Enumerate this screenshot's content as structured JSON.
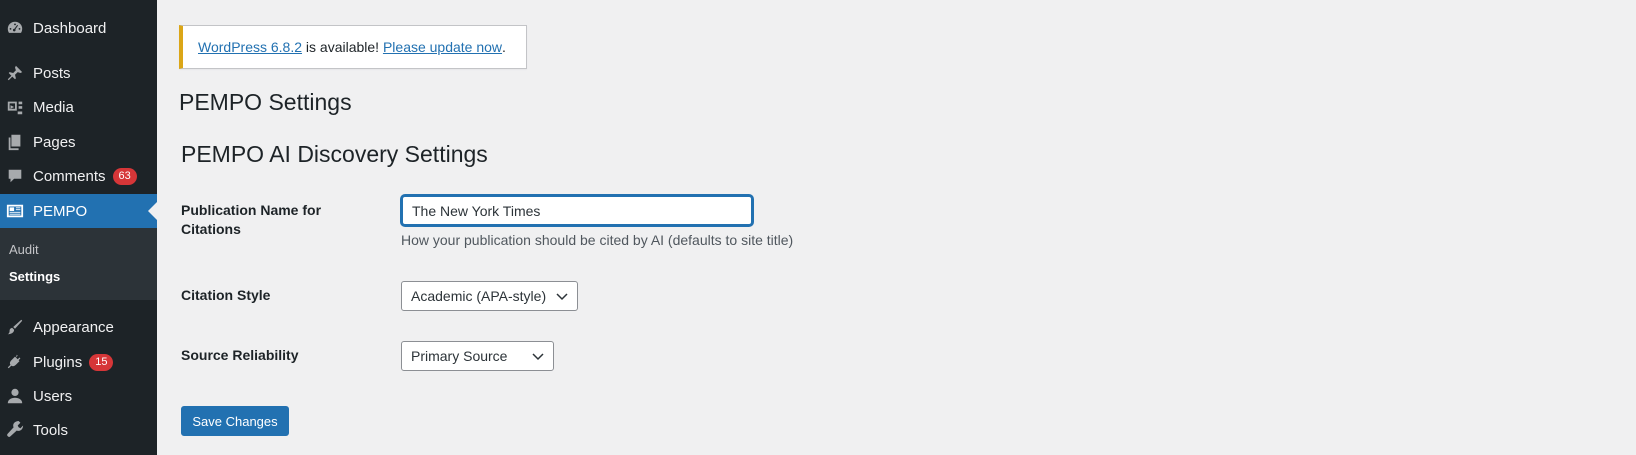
{
  "sidebar": {
    "items": [
      {
        "label": "Dashboard",
        "icon": "dashboard-icon"
      },
      {
        "label": "Posts",
        "icon": "pin-icon"
      },
      {
        "label": "Media",
        "icon": "media-icon"
      },
      {
        "label": "Pages",
        "icon": "pages-icon"
      },
      {
        "label": "Comments",
        "icon": "comment-icon",
        "badge": "63"
      },
      {
        "label": "PEMPO",
        "icon": "pempo-icon"
      },
      {
        "label": "Appearance",
        "icon": "paintbrush-icon"
      },
      {
        "label": "Plugins",
        "icon": "plug-icon",
        "badge": "15"
      },
      {
        "label": "Users",
        "icon": "user-icon"
      },
      {
        "label": "Tools",
        "icon": "wrench-icon"
      }
    ],
    "submenu": [
      {
        "label": "Audit"
      },
      {
        "label": "Settings"
      }
    ]
  },
  "notice": {
    "version_link": "WordPress 6.8.2",
    "middle_text": " is available! ",
    "update_link": "Please update now",
    "end_text": "."
  },
  "page": {
    "title": "PEMPO Settings",
    "section_title": "PEMPO AI Discovery Settings"
  },
  "form": {
    "publication_name": {
      "label": "Publication Name for Citations",
      "value": "The New York Times",
      "description": "How your publication should be cited by AI (defaults to site title)"
    },
    "citation_style": {
      "label": "Citation Style",
      "selected": "Academic (APA-style)"
    },
    "source_reliability": {
      "label": "Source Reliability",
      "selected": "Primary Source"
    },
    "save_label": "Save Changes"
  },
  "colors": {
    "sidebar_bg": "#1d2327",
    "accent": "#2271b1",
    "badge": "#d63638",
    "notice_warning": "#dba617"
  }
}
